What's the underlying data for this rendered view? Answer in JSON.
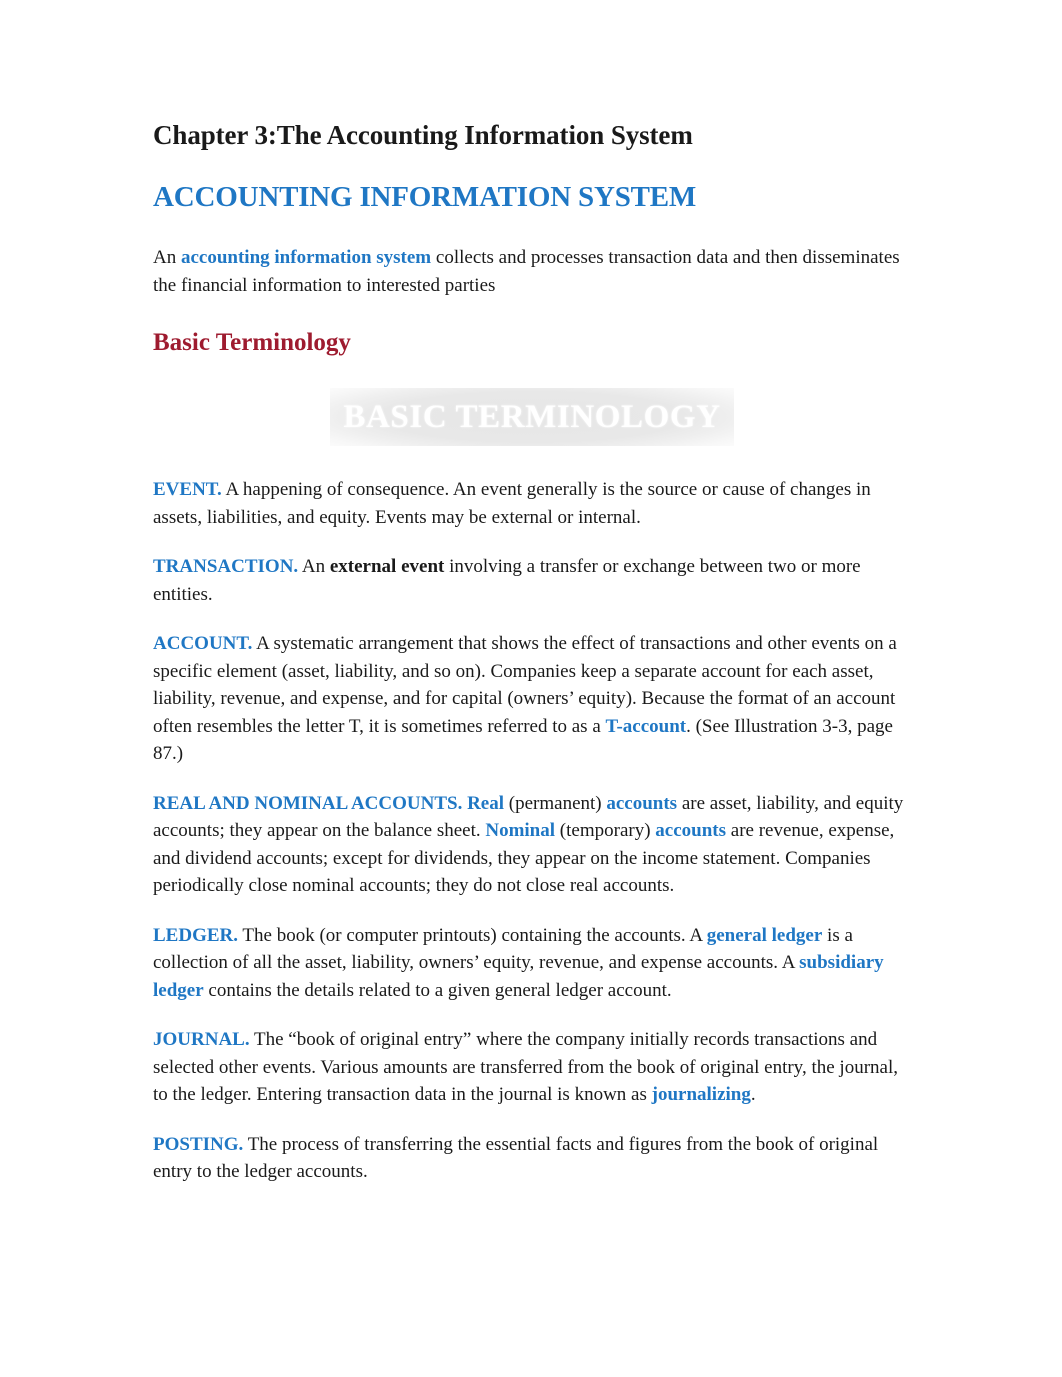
{
  "document": {
    "title": "Chapter 3:The Accounting Information System",
    "section_heading": "ACCOUNTING INFORMATION SYSTEM",
    "sub_heading": "Basic Terminology",
    "banner_text": "BASIC TERMINOLOGY"
  },
  "colors": {
    "accent_blue": "#1F77C4",
    "heading_red": "#9E1B2F",
    "body_text": "#1a1a1a",
    "banner_background": "#e8e8e8",
    "banner_text": "#ffffff",
    "page_background": "#ffffff"
  },
  "intro": {
    "lead": "An ",
    "keyword": "accounting information system",
    "rest": " collects and processes transaction data and then disseminates the financial information to interested parties"
  },
  "terms": [
    {
      "label": "EVENT.",
      "segments": [
        {
          "type": "plain",
          "text": " A happening of consequence. An event generally is the source or cause of changes in assets, liabilities, and equity. Events may be external or internal."
        }
      ]
    },
    {
      "label": "TRANSACTION.",
      "segments": [
        {
          "type": "plain",
          "text": "  An "
        },
        {
          "type": "bold",
          "text": "external event"
        },
        {
          "type": "plain",
          "text": " involving a transfer or exchange between two or more entities."
        }
      ]
    },
    {
      "label": "ACCOUNT.",
      "segments": [
        {
          "type": "plain",
          "text": " A systematic arrangement that shows the effect of transactions and other events on a specific element (asset, liability, and so on). Companies keep a separate account for each asset, liability, revenue, and expense, and for capital (owners’ equity). Because the format of an account often resembles the letter T, it is sometimes referred to as a "
        },
        {
          "type": "keyword",
          "text": "T-account"
        },
        {
          "type": "plain",
          "text": ". (See Illustration 3-3, page 87.)"
        }
      ]
    },
    {
      "label": "REAL AND NOMINAL ACCOUNTS.",
      "segments": [
        {
          "type": "keyword",
          "text": " Real"
        },
        {
          "type": "plain",
          "text": " (permanent) "
        },
        {
          "type": "keyword",
          "text": "accounts"
        },
        {
          "type": "plain",
          "text": " are asset, liability, and equity accounts; they appear on the balance sheet. "
        },
        {
          "type": "keyword",
          "text": "Nominal"
        },
        {
          "type": "plain",
          "text": " (temporary) "
        },
        {
          "type": "keyword",
          "text": "accounts"
        },
        {
          "type": "plain",
          "text": " are revenue, expense, and dividend accounts; except for dividends, they appear on the income statement. Companies periodically close nominal accounts; they do not close real accounts."
        }
      ]
    },
    {
      "label": "LEDGER.",
      "segments": [
        {
          "type": "plain",
          "text": " The book (or computer printouts) containing the accounts. A "
        },
        {
          "type": "keyword",
          "text": "general ledger"
        },
        {
          "type": "plain",
          "text": " is a collection of all the asset, liability, owners’ equity, revenue, and expense accounts. A "
        },
        {
          "type": "keyword",
          "text": "subsidiary ledger"
        },
        {
          "type": "plain",
          "text": " contains the details related to a given general ledger account."
        }
      ]
    },
    {
      "label": "JOURNAL.",
      "segments": [
        {
          "type": "plain",
          "text": " The “book of original entry” where the company initially records transactions and selected other events. Various amounts are transferred from the book of original entry, the journal, to the ledger. Entering transaction data in the journal is known as "
        },
        {
          "type": "keyword",
          "text": "journalizing"
        },
        {
          "type": "plain",
          "text": "."
        }
      ]
    },
    {
      "label": "POSTING.",
      "segments": [
        {
          "type": "plain",
          "text": " The process of transferring the essential facts and figures from the book of original entry to the ledger accounts."
        }
      ]
    }
  ]
}
